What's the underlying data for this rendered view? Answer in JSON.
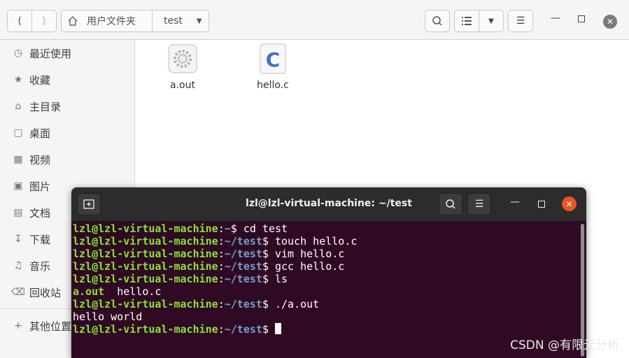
{
  "file_manager": {
    "path": {
      "home_label": "用户文件夹",
      "current": "test"
    },
    "sidebar": {
      "items": [
        {
          "label": "最近使用",
          "icon": "clock-icon"
        },
        {
          "label": "收藏",
          "icon": "star-icon"
        },
        {
          "label": "主目录",
          "icon": "home-icon"
        },
        {
          "label": "桌面",
          "icon": "desktop-icon"
        },
        {
          "label": "视频",
          "icon": "video-icon"
        },
        {
          "label": "图片",
          "icon": "picture-icon"
        },
        {
          "label": "文档",
          "icon": "document-icon"
        },
        {
          "label": "下载",
          "icon": "download-icon"
        },
        {
          "label": "音乐",
          "icon": "music-icon"
        },
        {
          "label": "回收站",
          "icon": "trash-icon"
        },
        {
          "label": "其他位置",
          "icon": "plus-icon"
        }
      ]
    },
    "files": [
      {
        "name": "a.out",
        "icon": "executable-gear-icon"
      },
      {
        "name": "hello.c",
        "icon": "c-source-icon"
      }
    ]
  },
  "terminal": {
    "title": "lzl@lzl-virtual-machine: ~/test",
    "lines": [
      {
        "user": "lzl@lzl-virtual-machine",
        "path": "~",
        "cmd": " cd test"
      },
      {
        "user": "lzl@lzl-virtual-machine",
        "path": "~/test",
        "cmd": " touch hello.c"
      },
      {
        "user": "lzl@lzl-virtual-machine",
        "path": "~/test",
        "cmd": " vim hello.c"
      },
      {
        "user": "lzl@lzl-virtual-machine",
        "path": "~/test",
        "cmd": " gcc hello.c"
      },
      {
        "user": "lzl@lzl-virtual-machine",
        "path": "~/test",
        "cmd": " ls"
      },
      {
        "exec": "a.out",
        "plain": "  hello.c"
      },
      {
        "user": "lzl@lzl-virtual-machine",
        "path": "~/test",
        "cmd": " ./a.out"
      },
      {
        "plain_only": "hello world"
      },
      {
        "user": "lzl@lzl-virtual-machine",
        "path": "~/test",
        "cmd": " "
      }
    ]
  },
  "watermark": "CSDN @有限元分析",
  "colors": {
    "prompt_user": "#8ae234",
    "prompt_path": "#729fcf",
    "terminal_bg": "#300a24"
  }
}
